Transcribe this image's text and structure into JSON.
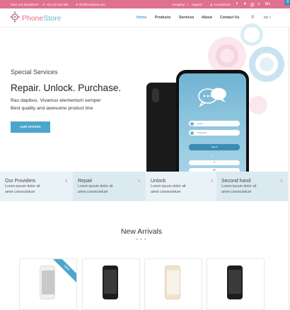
{
  "topbar": {
    "question": "Have any Questions?",
    "phone": "+01 123 444 555",
    "email": "info@company.com",
    "company_menu": "Company",
    "support": "Support",
    "account": "Account/Join",
    "social": [
      "f",
      "✦",
      "ⓟ",
      "t",
      "G+"
    ]
  },
  "brand": {
    "part1": "Phone",
    "part2": "Store"
  },
  "nav": {
    "items": [
      "Home",
      "Products",
      "Services",
      "About",
      "Contact Us"
    ],
    "active": "Home",
    "lang": "DE ˅"
  },
  "hero": {
    "kicker": "Special Services",
    "title": "Repair. Unlock. Purchase.",
    "line1": "Ras dapibus. Vivamus elementum semper",
    "line2": "Best quality and awesome product line",
    "button": "OUR OFFERS"
  },
  "phone_screen": {
    "email_placeholder": "Email",
    "password_placeholder": "Password",
    "login": "Log in",
    "or": "or",
    "facebook": "f",
    "google": "G+"
  },
  "services": [
    {
      "title": "Our Providers",
      "text1": "Lorem ipsum dolor sit",
      "text2": "amet consectetuer"
    },
    {
      "title": "Repair",
      "text1": "Lorem ipsum dolor sit",
      "text2": "amet consectetuer"
    },
    {
      "title": "Unlock",
      "text1": "Lorem ipsum dolor sit",
      "text2": "amet consectetuer"
    },
    {
      "title": "Second hand",
      "text1": "Lorem ipsum dolor sit",
      "text2": "amet consectetuer"
    }
  ],
  "new_arrivals": {
    "title": "New Arrivals",
    "dots": "• • •",
    "ribbon": "SALE"
  },
  "colors": {
    "pink": "#e0708f",
    "blue": "#4aa6cc",
    "service_bg_light": "#e9f2f6",
    "service_bg_dark": "#dbeaf1"
  }
}
